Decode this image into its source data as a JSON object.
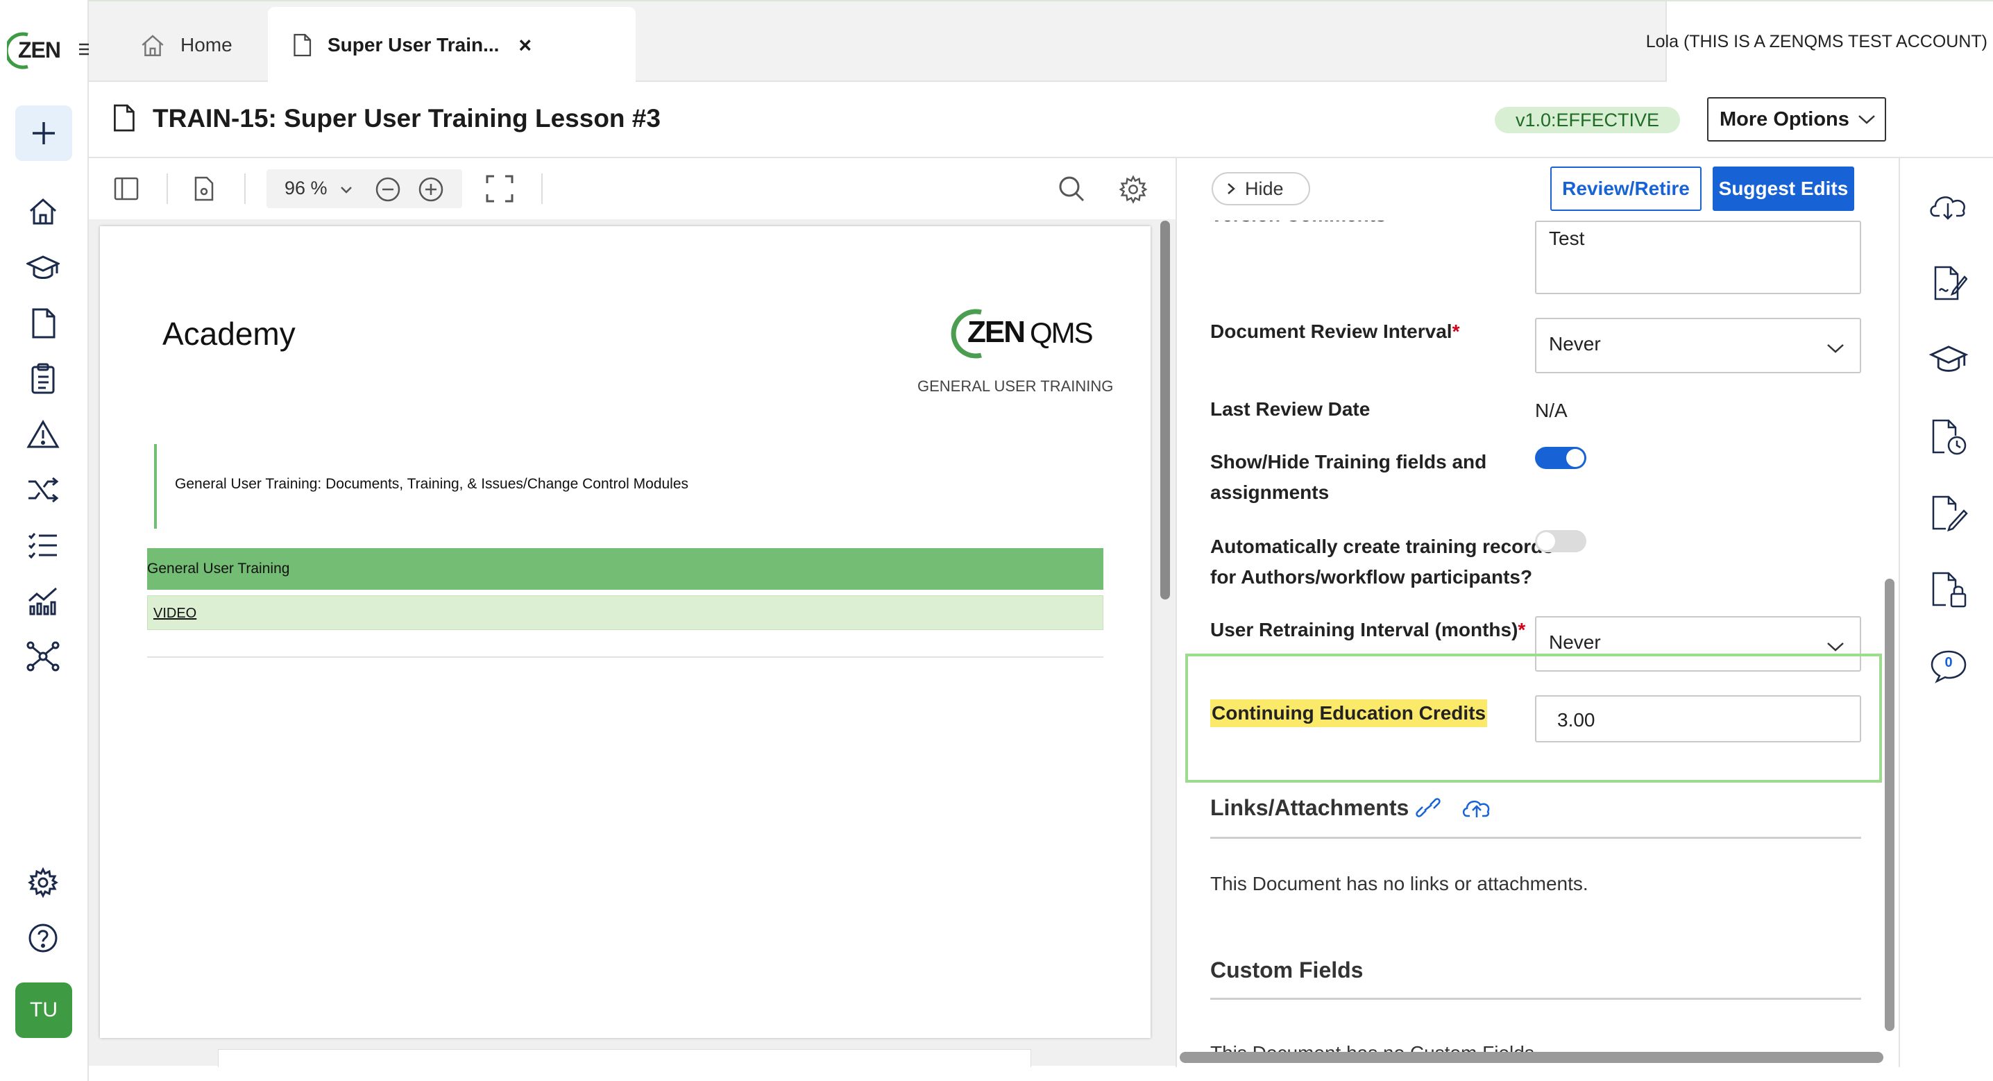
{
  "app": {
    "logo_text": "ZEN"
  },
  "tabs": [
    {
      "label": "Home",
      "icon": "home-icon"
    },
    {
      "label": "Super User Train...",
      "icon": "document-icon",
      "close": "×"
    }
  ],
  "user": {
    "account_label": "Lola (THIS IS A ZENQMS TEST ACCOUNT)",
    "initials": "TU"
  },
  "document": {
    "title": "TRAIN-15: Super User Training Lesson #3",
    "version_badge": "v1.0:EFFECTIVE",
    "more_options": "More Options",
    "close": "×"
  },
  "viewer": {
    "zoom": "96 %",
    "page": {
      "heading": "Academy",
      "brand": {
        "zen": "ZEN",
        "qms": "QMS"
      },
      "brand_subtitle": "GENERAL USER TRAINING",
      "callout": "General User Training: Documents, Training, & Issues/Change Control Modules",
      "green_bar": "General User Training",
      "video_link": "VIDEO"
    }
  },
  "panel": {
    "hide_label": "Hide",
    "review_retire": "Review/Retire",
    "suggest_edits": "Suggest Edits",
    "version_comments_label": "Version Comments",
    "version_comments_value": "Test",
    "review_interval_label": "Document Review Interval",
    "review_interval_value": "Never",
    "last_review_label": "Last Review Date",
    "last_review_value": "N/A",
    "show_training_label_1": "Show/Hide Training fields and",
    "show_training_label_2": "assignments",
    "show_training_on": true,
    "auto_create_label_1": "Automatically create training records",
    "auto_create_label_2": "for Authors/workflow participants?",
    "auto_create_on": false,
    "retraining_label": "User Retraining Interval (months)",
    "retraining_value": "Never",
    "ce_credits_label": "Continuing Education Credits",
    "ce_credits_value": "3.00",
    "links_title": "Links/Attachments",
    "links_empty": "This Document has no links or attachments.",
    "custom_fields_title": "Custom Fields",
    "custom_fields_empty": "This Document has no Custom Fields."
  },
  "rail": {
    "comment_count": "0"
  },
  "colors": {
    "brand_green": "#3f9b43",
    "primary_blue": "#1763d6",
    "badge_green_bg": "#d8efd4",
    "highlight_yellow": "#fbe96a",
    "focus_outline": "#9ddc8f",
    "bar_green": "#74bd74",
    "bar_light_green": "#dcefd3"
  }
}
